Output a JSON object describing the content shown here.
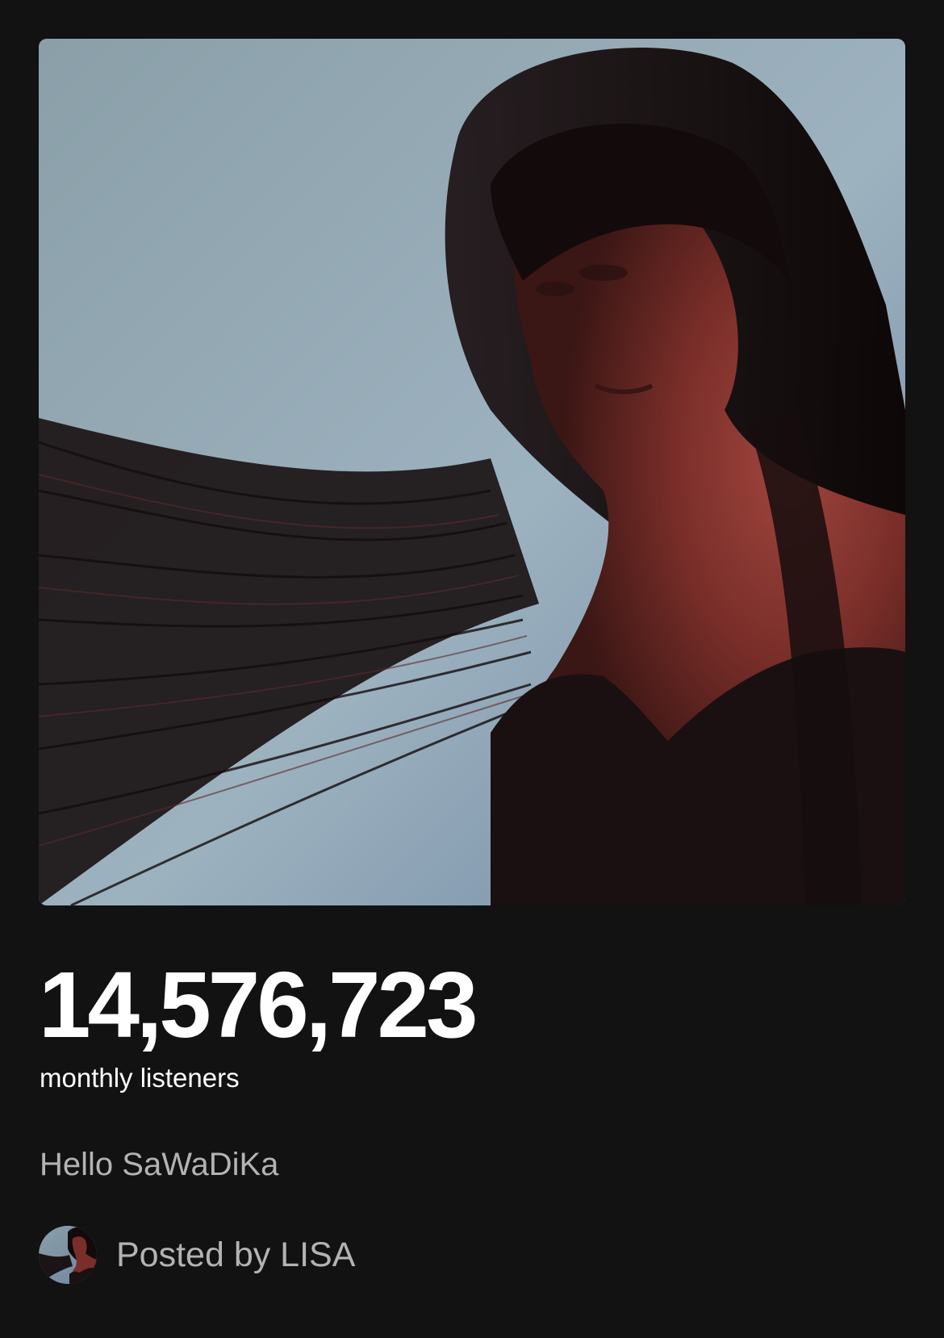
{
  "artist_card": {
    "image_icon": "artist-portrait-photo",
    "monthly_listeners": "14,576,723",
    "monthly_listeners_label": "monthly listeners",
    "bio": "Hello SaWaDiKa",
    "posted_by": {
      "avatar_icon": "artist-avatar",
      "label": "Posted by LISA"
    }
  },
  "colors": {
    "background": "#121212",
    "primary_text": "#ffffff",
    "secondary_text": "#b3b3b3"
  }
}
